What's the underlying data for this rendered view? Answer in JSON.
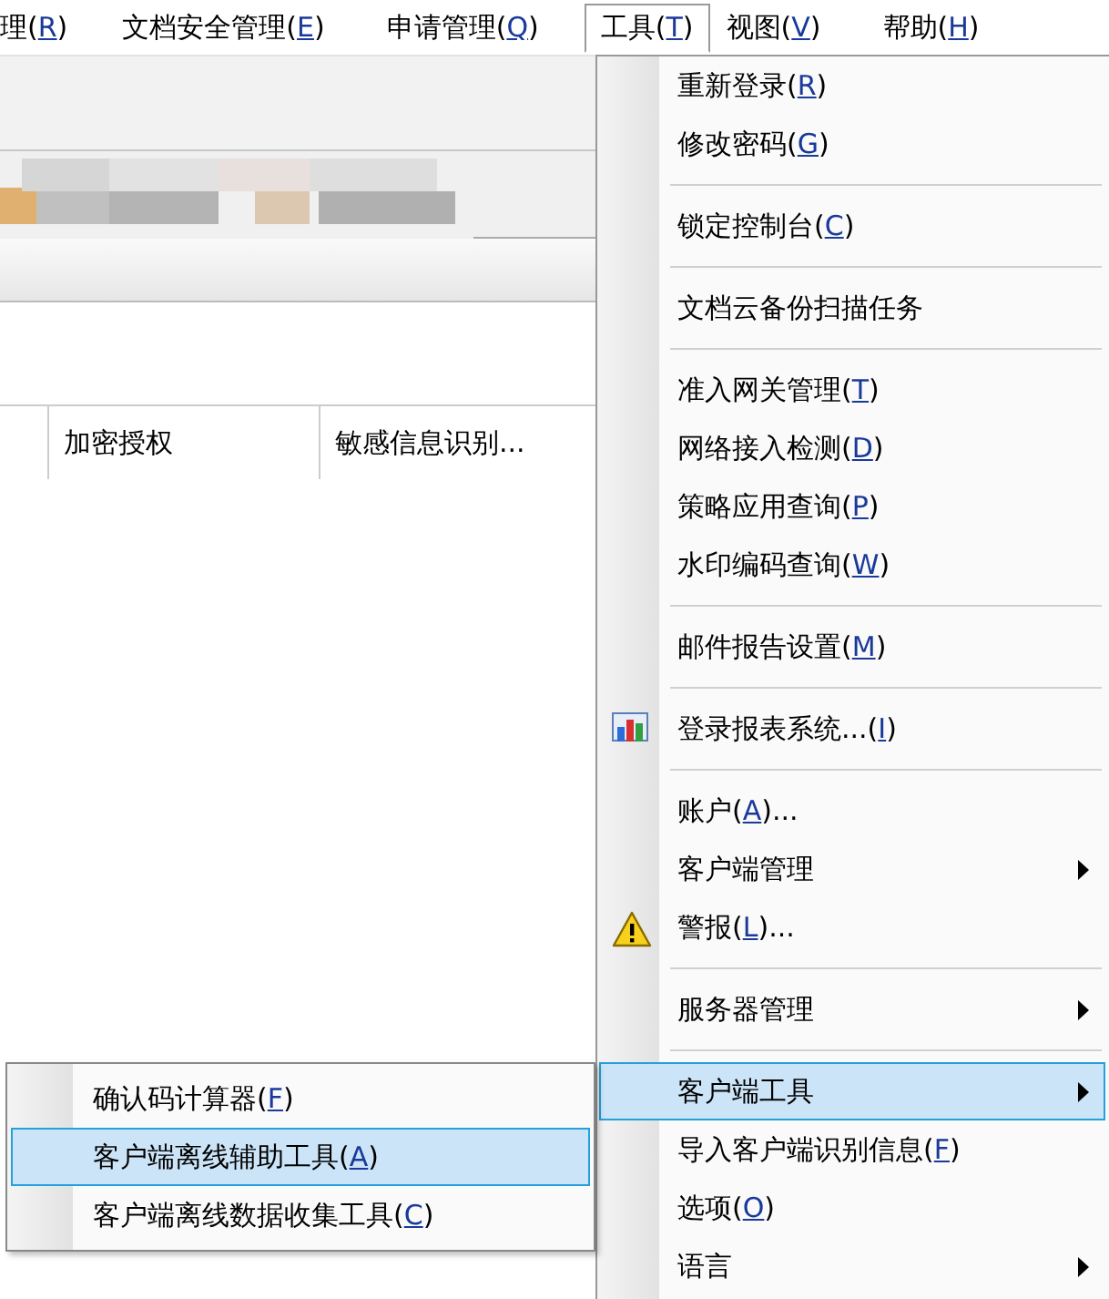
{
  "menubar": [
    {
      "label": "理(",
      "mnemonic": "R",
      "after": ")",
      "selected": false
    },
    {
      "label": "文档安全管理(",
      "mnemonic": "E",
      "after": ")",
      "selected": false
    },
    {
      "label": "申请管理(",
      "mnemonic": "Q",
      "after": ")",
      "selected": false
    },
    {
      "label": "工具(",
      "mnemonic": "T",
      "after": ")",
      "selected": true
    },
    {
      "label": "视图(",
      "mnemonic": "V",
      "after": ")",
      "selected": false
    },
    {
      "label": "帮助(",
      "mnemonic": "H",
      "after": ")",
      "selected": false
    }
  ],
  "table": {
    "columns": [
      "加密授权",
      "敏感信息识别..."
    ]
  },
  "tools_menu": [
    {
      "kind": "item",
      "label": "重新登录(",
      "mnemonic": "R",
      "after": ")",
      "selected": false
    },
    {
      "kind": "item",
      "label": "修改密码(",
      "mnemonic": "G",
      "after": ")",
      "selected": false
    },
    {
      "kind": "separator"
    },
    {
      "kind": "item",
      "label": "锁定控制台(",
      "mnemonic": "C",
      "after": ")",
      "selected": false
    },
    {
      "kind": "separator"
    },
    {
      "kind": "item",
      "label": "文档云备份扫描任务",
      "selected": false
    },
    {
      "kind": "separator"
    },
    {
      "kind": "item",
      "label": "准入网关管理(",
      "mnemonic": "T",
      "after": ")",
      "selected": false
    },
    {
      "kind": "item",
      "label": "网络接入检测(",
      "mnemonic": "D",
      "after": ")",
      "selected": false
    },
    {
      "kind": "item",
      "label": "策略应用查询(",
      "mnemonic": "P",
      "after": ")",
      "selected": false
    },
    {
      "kind": "item",
      "label": "水印编码查询(",
      "mnemonic": "W",
      "after": ")",
      "selected": false
    },
    {
      "kind": "separator"
    },
    {
      "kind": "item",
      "label": "邮件报告设置(",
      "mnemonic": "M",
      "after": ")",
      "selected": false
    },
    {
      "kind": "separator"
    },
    {
      "kind": "chart_item",
      "label": "登录报表系统...(",
      "mnemonic": "I",
      "after": ")",
      "selected": false
    },
    {
      "kind": "separator"
    },
    {
      "kind": "item",
      "label": "账户(",
      "mnemonic": "A",
      "after": ")...",
      "selected": false
    },
    {
      "kind": "item",
      "label": "客户端管理",
      "submenu": true,
      "selected": false
    },
    {
      "kind": "warning_item",
      "label": "警报(",
      "mnemonic": "L",
      "after": ")...",
      "selected": false
    },
    {
      "kind": "separator"
    },
    {
      "kind": "item",
      "label": "服务器管理",
      "submenu": true,
      "selected": false
    },
    {
      "kind": "separator"
    },
    {
      "kind": "item",
      "label": "客户端工具",
      "submenu": true,
      "selected": true
    },
    {
      "kind": "item",
      "label": "导入客户端识别信息(",
      "mnemonic": "F",
      "after": ")",
      "selected": false
    },
    {
      "kind": "item",
      "label": "选项(",
      "mnemonic": "O",
      "after": ")",
      "selected": false
    },
    {
      "kind": "item",
      "label": "语言",
      "submenu": true,
      "selected": false
    }
  ],
  "client_tools_submenu": [
    {
      "label": "确认码计算器(",
      "mnemonic": "F",
      "after": ")",
      "selected": false
    },
    {
      "label": "客户端离线辅助工具(",
      "mnemonic": "A",
      "after": ")",
      "selected": true
    },
    {
      "label": "客户端离线数据收集工具(",
      "mnemonic": "C",
      "after": ")",
      "selected": false
    }
  ]
}
